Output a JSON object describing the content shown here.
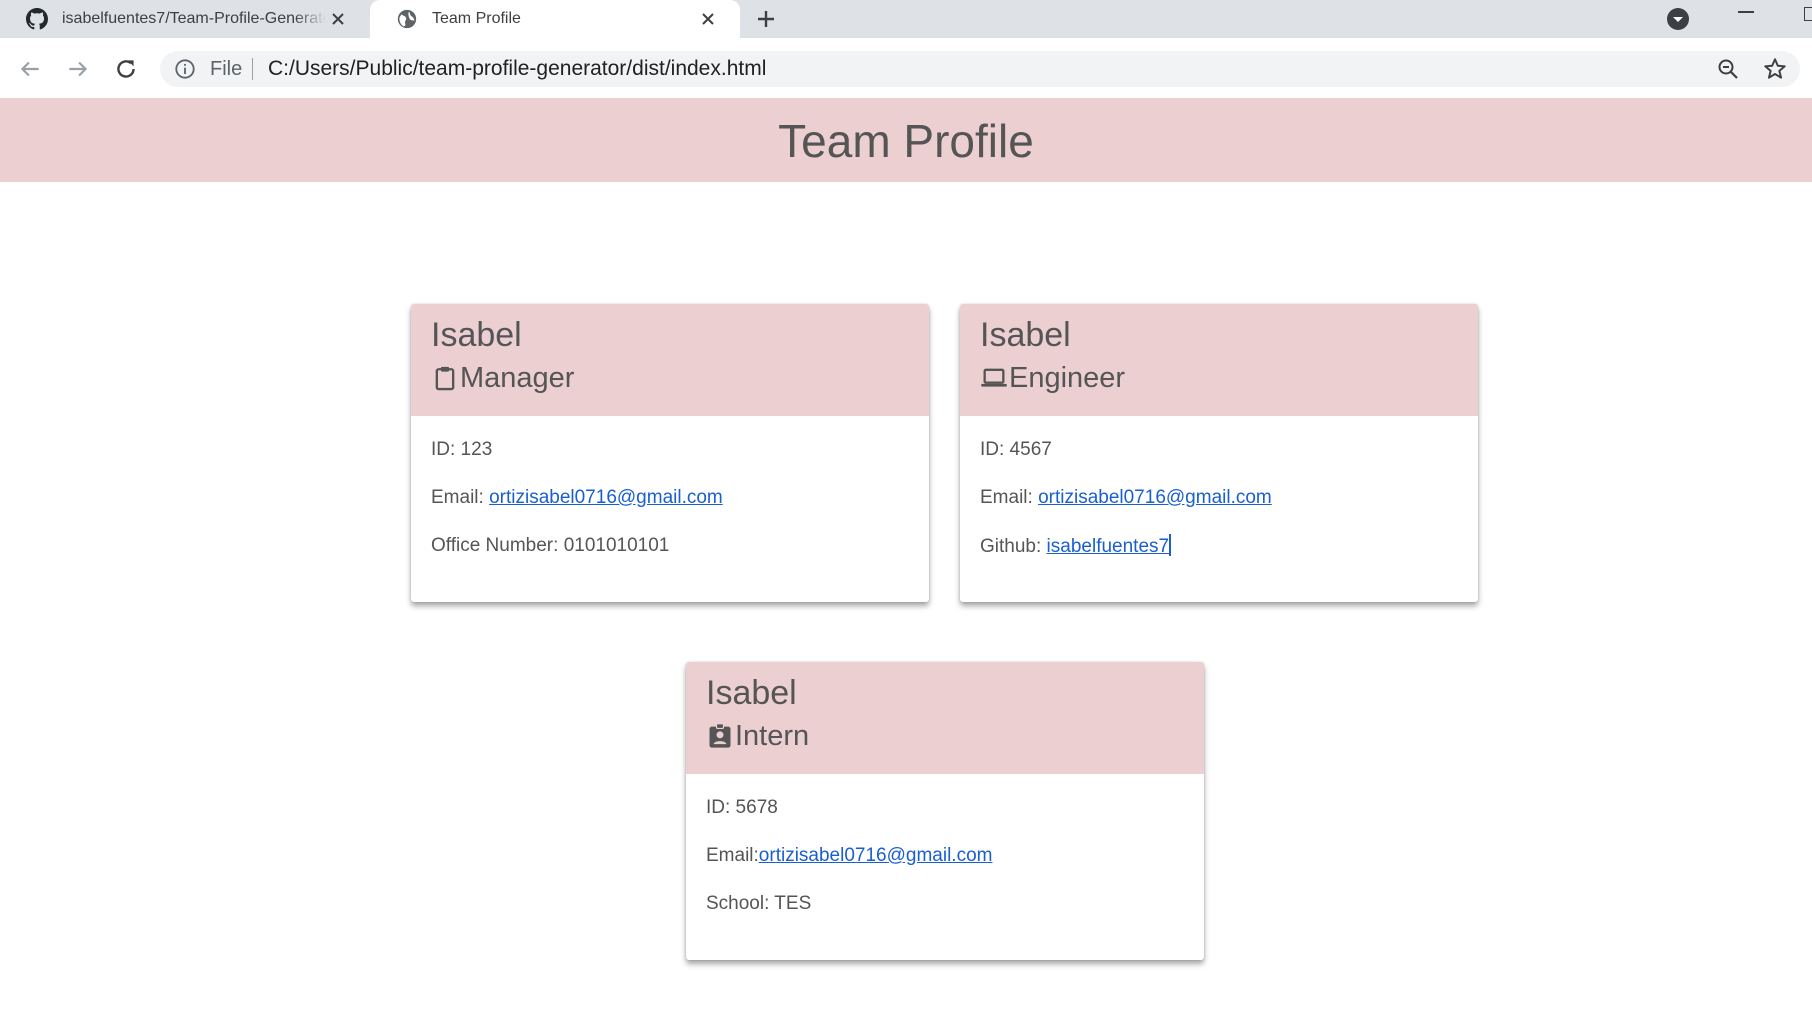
{
  "browser": {
    "tabs": [
      {
        "title": "isabelfuentes7/Team-Profile-Generator",
        "icon": "github-icon",
        "active": false
      },
      {
        "title": "Team Profile",
        "icon": "globe-icon",
        "active": true
      }
    ],
    "address_scheme": "File",
    "address_url": "C:/Users/Public/team-profile-generator/dist/index.html"
  },
  "page": {
    "title": "Team Profile",
    "header_color": "#ecd0d1",
    "link_color": "#1a5fd0"
  },
  "cards": {
    "manager": {
      "name": "Isabel",
      "role": "Manager",
      "role_icon": "clipboard-icon",
      "id_text": "ID: 123",
      "email_label": "Email: ",
      "email": "ortizisabel0716@gmail.com",
      "extra_text": "Office Number: 0101010101"
    },
    "engineer": {
      "name": "Isabel",
      "role": "Engineer",
      "role_icon": "laptop-icon",
      "id_text": "ID: 4567",
      "email_label": "Email: ",
      "email": "ortizisabel0716@gmail.com",
      "github_label": "Github: ",
      "github": "isabelfuentes7"
    },
    "intern": {
      "name": "Isabel",
      "role": "Intern",
      "role_icon": "user-badge-icon",
      "id_text": "ID: 5678",
      "email_label": "Email:",
      "email": "ortizisabel0716@gmail.com",
      "extra_text": "School: TES"
    }
  }
}
